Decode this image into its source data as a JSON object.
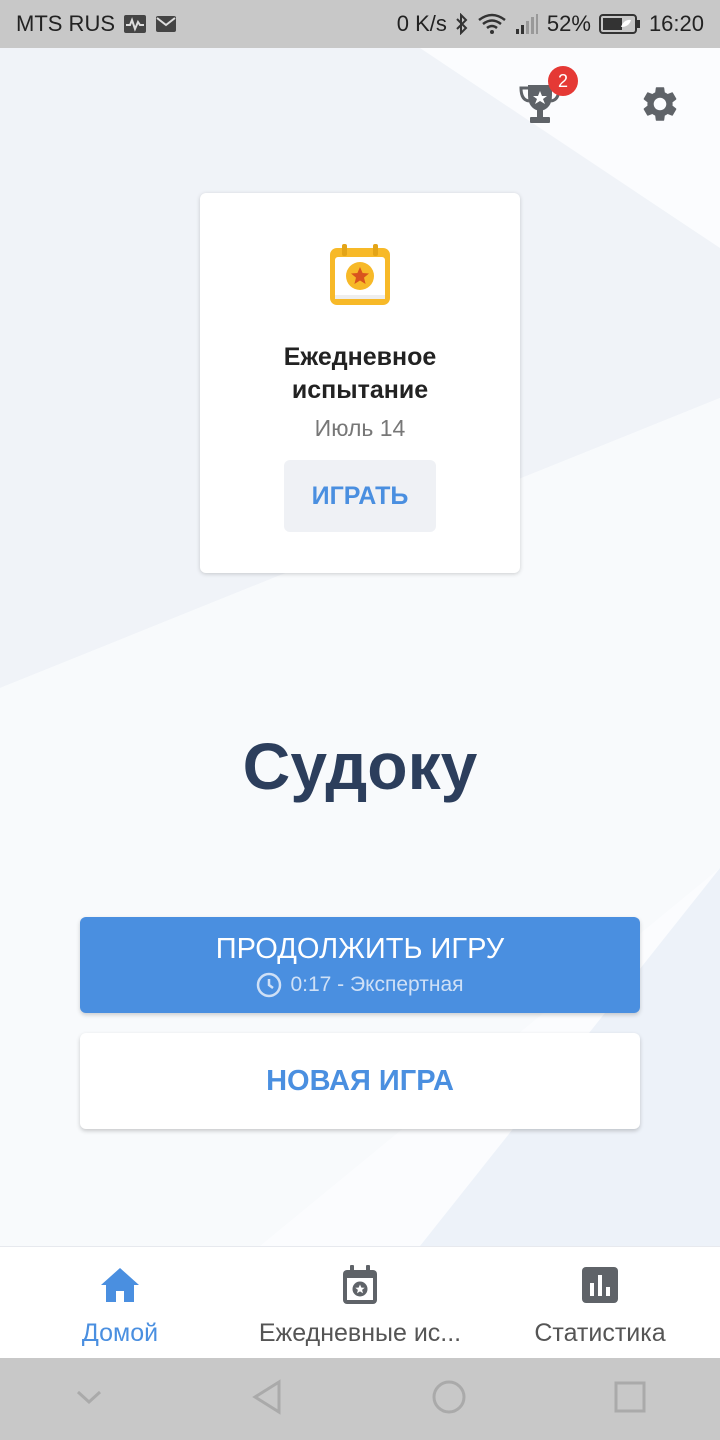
{
  "status_bar": {
    "carrier": "MTS RUS",
    "speed": "0 K/s",
    "battery": "52%",
    "time": "16:20"
  },
  "header": {
    "trophy_badge_count": "2",
    "trophy_icon": "trophy-icon",
    "settings_icon": "gear-icon"
  },
  "daily_challenge": {
    "title": "Ежедневное испытание",
    "date": "Июль 14",
    "play_label": "ИГРАТЬ"
  },
  "app_title": "Судоку",
  "continue_game": {
    "label": "ПРОДОЛЖИТЬ ИГРУ",
    "details": "0:17 - Экспертная"
  },
  "new_game": {
    "label": "НОВАЯ ИГРА"
  },
  "bottom_nav": {
    "items": [
      {
        "label": "Домой",
        "icon": "home-icon",
        "active": true
      },
      {
        "label": "Ежедневные ис...",
        "icon": "calendar-star-icon",
        "active": false
      },
      {
        "label": "Статистика",
        "icon": "bar-chart-icon",
        "active": false
      }
    ]
  },
  "colors": {
    "accent": "#4a8fe0",
    "title": "#2c3e5c",
    "badge": "#e53935",
    "calendar": "#f7b928"
  }
}
